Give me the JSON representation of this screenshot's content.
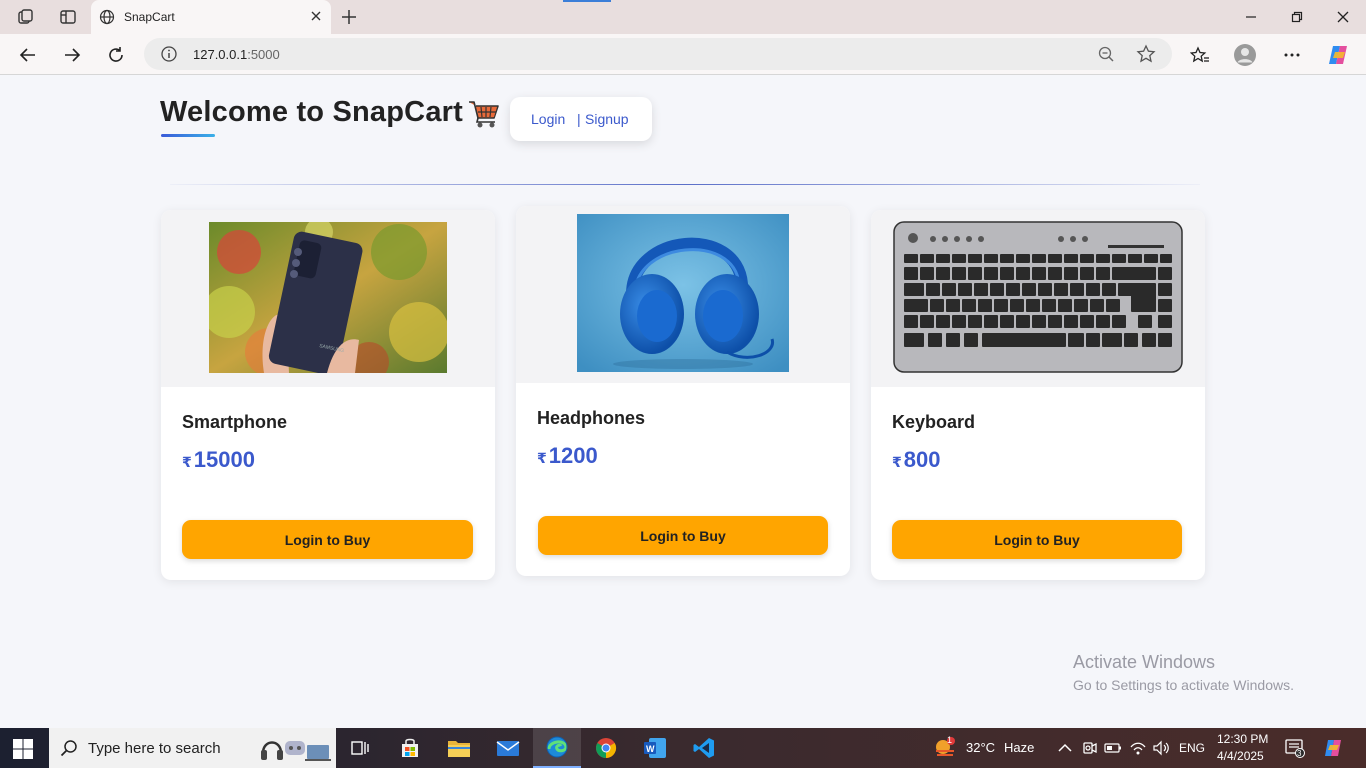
{
  "browser": {
    "tab_title": "SnapCart",
    "url_host": "127.0.0.1",
    "url_port": ":5000"
  },
  "page": {
    "title": "Welcome to SnapCart",
    "auth": {
      "login": "Login",
      "separator": "|",
      "signup": "Signup"
    },
    "products": [
      {
        "name": "Smartphone",
        "currency": "₹",
        "price": "15000",
        "button": "Login to Buy",
        "image": "smartphone-image"
      },
      {
        "name": "Headphones",
        "currency": "₹",
        "price": "1200",
        "button": "Login to Buy",
        "image": "headphones-image"
      },
      {
        "name": "Keyboard",
        "currency": "₹",
        "price": "800",
        "button": "Login to Buy",
        "image": "keyboard-image"
      }
    ]
  },
  "watermark": {
    "line1": "Activate Windows",
    "line2": "Go to Settings to activate Windows."
  },
  "taskbar": {
    "search_placeholder": "Type here to search",
    "weather_temp": "32°C",
    "weather_desc": "Haze",
    "weather_badge": "1",
    "language": "ENG",
    "time": "12:30 PM",
    "date": "4/4/2025",
    "notification_count": "3"
  },
  "colors": {
    "accent": "#3b59cc",
    "buy_button": "#ffa500",
    "page_bg": "#f5f6fa"
  }
}
